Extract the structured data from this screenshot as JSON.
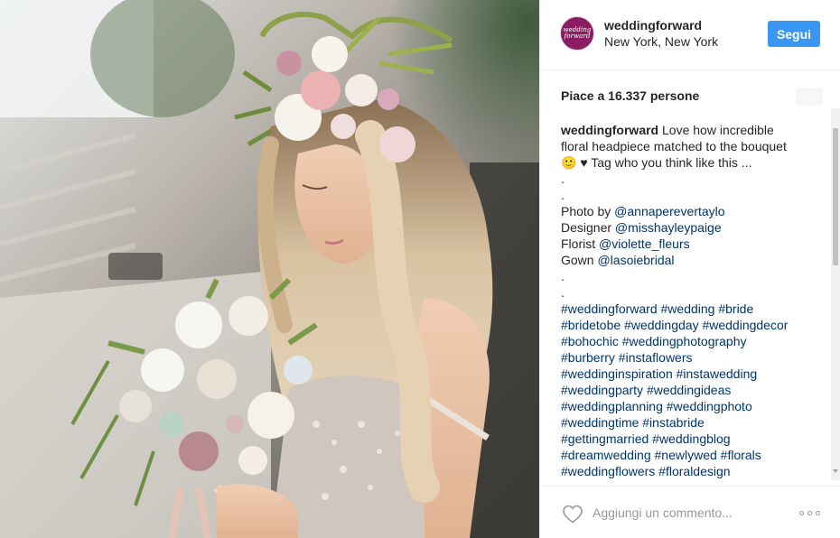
{
  "post": {
    "username": "weddingforward",
    "location": "New York, New York",
    "follow_label": "Segui",
    "avatar_text": "wedding\nforward",
    "likes_text": "Piace a 16.337 persone"
  },
  "caption": {
    "username": "weddingforward",
    "lead_lines": [
      "Love how incredible",
      "floral headpiece matched to the bouquet",
      "🙂 ♥ Tag who you think like this ..."
    ],
    "dot1": ".",
    "dot2": ".",
    "credits": [
      {
        "label": "Photo by",
        "handle": "@annaperevertaylo"
      },
      {
        "label": "Designer",
        "handle": "@misshayleypaige"
      },
      {
        "label": "Florist",
        "handle": "@violette_fleurs"
      },
      {
        "label": "Gown",
        "handle": "@lasoiebridal"
      }
    ],
    "dot3": ".",
    "dot4": ".",
    "hashtag_lines": [
      "#weddingforward #wedding #bride",
      "#bridetobe #weddingday #weddingdecor",
      "#bohochic #weddingphotography",
      "#burberry #instaflowers",
      "#weddinginspiration #instawedding",
      "#weddingparty #weddingideas",
      "#weddingplanning #weddingphoto",
      "#weddingtime #instabride",
      "#gettingmarried #weddingblog",
      "#dreamwedding #newlywed #florals",
      "#weddingflowers #floraldesign"
    ]
  },
  "comment": {
    "placeholder": "Aggiungi un commento..."
  },
  "colors": {
    "follow_button": "#3897f0",
    "link": "#003569",
    "avatar_bg": "#8b1d63"
  },
  "icons": [
    "heart-icon",
    "more-options-icon",
    "chevron-down-icon"
  ]
}
